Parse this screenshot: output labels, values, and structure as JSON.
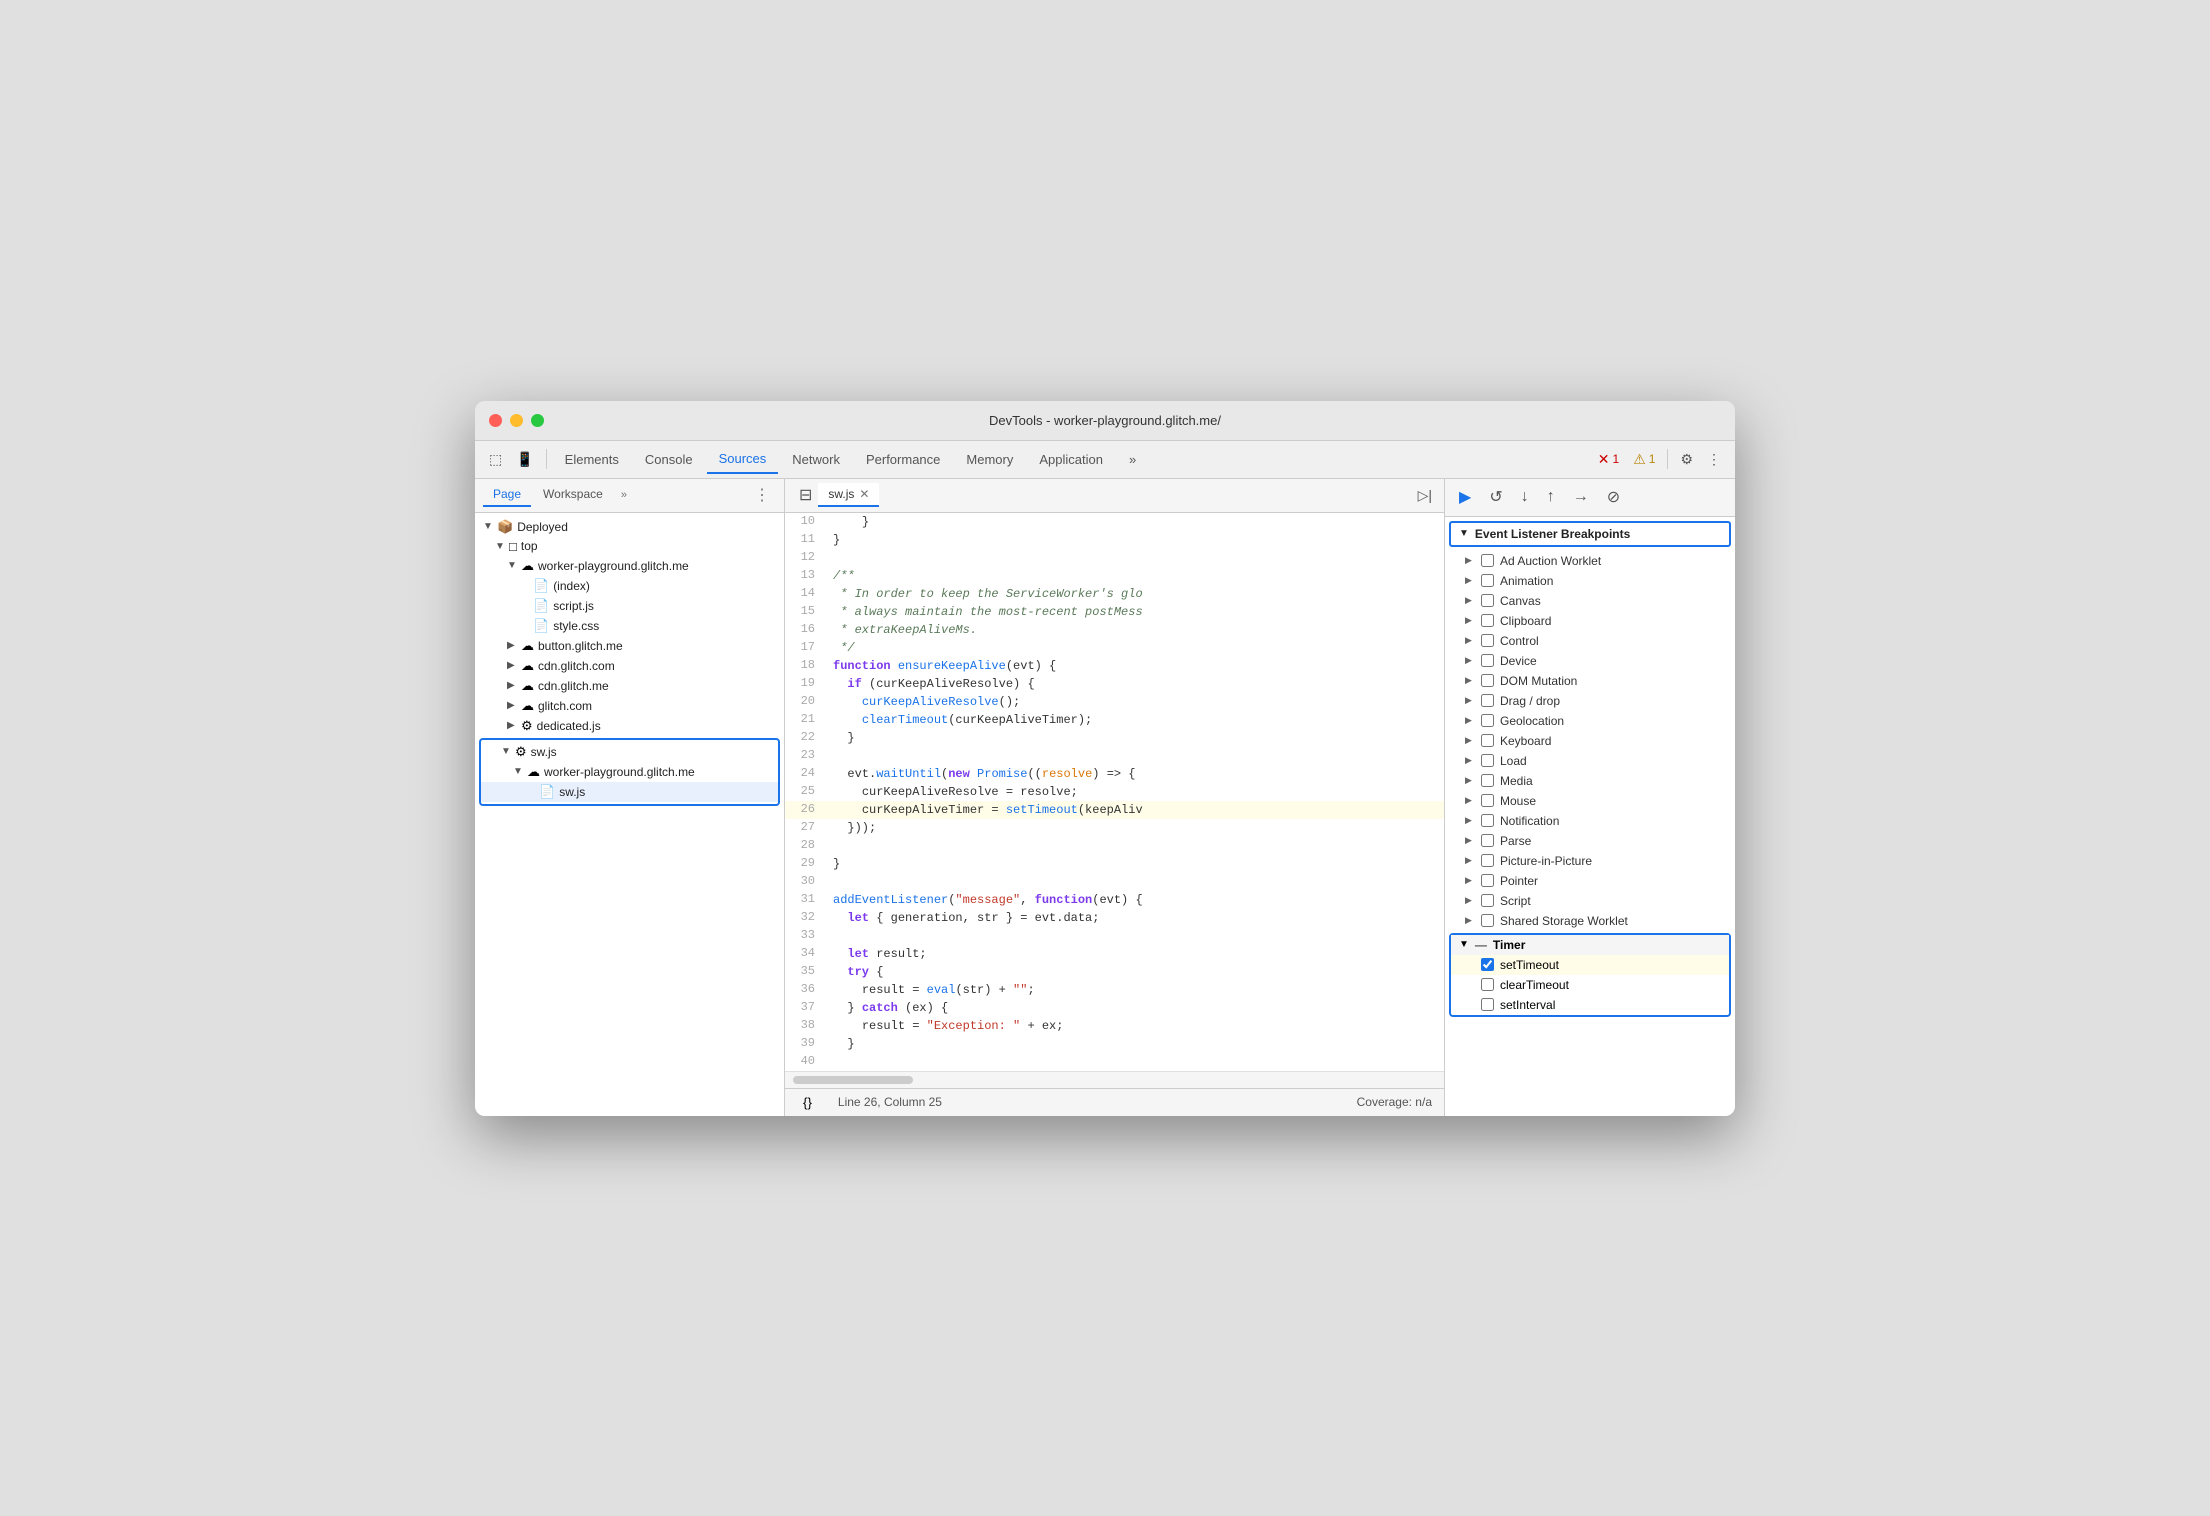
{
  "window": {
    "title": "DevTools - worker-playground.glitch.me/"
  },
  "toolbar": {
    "tabs": [
      {
        "label": "Elements",
        "active": false
      },
      {
        "label": "Console",
        "active": false
      },
      {
        "label": "Sources",
        "active": true
      },
      {
        "label": "Network",
        "active": false
      },
      {
        "label": "Performance",
        "active": false
      },
      {
        "label": "Memory",
        "active": false
      },
      {
        "label": "Application",
        "active": false
      }
    ],
    "more_label": "»",
    "error_count": "1",
    "warning_count": "1"
  },
  "file_panel": {
    "tabs": [
      {
        "label": "Page",
        "active": true
      },
      {
        "label": "Workspace",
        "active": false
      }
    ],
    "more_label": "»",
    "tree": [
      {
        "id": "deployed",
        "label": "Deployed",
        "depth": 0,
        "expanded": true,
        "icon": "📦"
      },
      {
        "id": "top",
        "label": "top",
        "depth": 1,
        "expanded": true,
        "icon": "□"
      },
      {
        "id": "worker-playground",
        "label": "worker-playground.glitch.me",
        "depth": 2,
        "expanded": true,
        "icon": "☁"
      },
      {
        "id": "index",
        "label": "(index)",
        "depth": 3,
        "icon": "📄"
      },
      {
        "id": "script-js",
        "label": "script.js",
        "depth": 3,
        "icon": "📄"
      },
      {
        "id": "style-css",
        "label": "style.css",
        "depth": 3,
        "icon": "📄"
      },
      {
        "id": "button-glitch",
        "label": "button.glitch.me",
        "depth": 2,
        "icon": "☁"
      },
      {
        "id": "cdn-glitch-com",
        "label": "cdn.glitch.com",
        "depth": 2,
        "icon": "☁"
      },
      {
        "id": "cdn-glitch-me",
        "label": "cdn.glitch.me",
        "depth": 2,
        "icon": "☁"
      },
      {
        "id": "glitch-com",
        "label": "glitch.com",
        "depth": 2,
        "icon": "☁"
      },
      {
        "id": "dedicated-js",
        "label": "dedicated.js",
        "depth": 2,
        "icon": "⚙"
      },
      {
        "id": "sw-js-group-start",
        "label": "sw.js",
        "depth": 1,
        "expanded": true,
        "icon": "⚙",
        "group_start": true
      },
      {
        "id": "worker-playground-2",
        "label": "worker-playground.glitch.me",
        "depth": 2,
        "icon": "☁",
        "in_group": true
      },
      {
        "id": "sw-js-file",
        "label": "sw.js",
        "depth": 3,
        "icon": "📄",
        "in_group": true,
        "selected": true
      }
    ]
  },
  "code_panel": {
    "file_tab": "sw.js",
    "lines": [
      {
        "num": 10,
        "content": "    }"
      },
      {
        "num": 11,
        "content": "}"
      },
      {
        "num": 12,
        "content": ""
      },
      {
        "num": 13,
        "content": "/**",
        "type": "comment"
      },
      {
        "num": 14,
        "content": " * In order to keep the ServiceWorker's glo",
        "type": "comment"
      },
      {
        "num": 15,
        "content": " * always maintain the most-recent postMess",
        "type": "comment"
      },
      {
        "num": 16,
        "content": " * extraKeepAliveMs.",
        "type": "comment"
      },
      {
        "num": 17,
        "content": " */",
        "type": "comment"
      },
      {
        "num": 18,
        "content": "function ensureKeepAlive(evt) {",
        "type": "code"
      },
      {
        "num": 19,
        "content": "  if (curKeepAliveResolve) {",
        "type": "code"
      },
      {
        "num": 20,
        "content": "    curKeepAliveResolve();",
        "type": "code"
      },
      {
        "num": 21,
        "content": "    clearTimeout(curKeepAliveTimer);",
        "type": "code"
      },
      {
        "num": 22,
        "content": "  }",
        "type": "code"
      },
      {
        "num": 23,
        "content": ""
      },
      {
        "num": 24,
        "content": "  evt.waitUntil(new Promise((resolve) => {",
        "type": "code"
      },
      {
        "num": 25,
        "content": "    curKeepAliveResolve = resolve;",
        "type": "code"
      },
      {
        "num": 26,
        "content": "    curKeepAliveTimer = setTimeout(keepAliv",
        "type": "code",
        "highlighted": true
      },
      {
        "num": 27,
        "content": "  }));",
        "type": "code"
      },
      {
        "num": 28,
        "content": ""
      },
      {
        "num": 29,
        "content": "}"
      },
      {
        "num": 30,
        "content": ""
      },
      {
        "num": 31,
        "content": "addEventListener(\"message\", function(evt) {",
        "type": "code"
      },
      {
        "num": 32,
        "content": "  let { generation, str } = evt.data;",
        "type": "code"
      },
      {
        "num": 33,
        "content": ""
      },
      {
        "num": 34,
        "content": "  let result;",
        "type": "code"
      },
      {
        "num": 35,
        "content": "  try {",
        "type": "code"
      },
      {
        "num": 36,
        "content": "    result = eval(str) + \"\";",
        "type": "code"
      },
      {
        "num": 37,
        "content": "  } catch (ex) {",
        "type": "code"
      },
      {
        "num": 38,
        "content": "    result = \"Exception: \" + ex;",
        "type": "code"
      },
      {
        "num": 39,
        "content": "  }",
        "type": "code"
      },
      {
        "num": 40,
        "content": ""
      }
    ],
    "status": {
      "format_label": "{}",
      "position": "Line 26, Column 25",
      "coverage": "Coverage: n/a"
    }
  },
  "right_panel": {
    "event_listener_breakpoints_label": "Event Listener Breakpoints",
    "breakpoints": [
      {
        "label": "Ad Auction Worklet",
        "checked": false,
        "expandable": true
      },
      {
        "label": "Animation",
        "checked": false,
        "expandable": true
      },
      {
        "label": "Canvas",
        "checked": false,
        "expandable": true
      },
      {
        "label": "Clipboard",
        "checked": false,
        "expandable": true
      },
      {
        "label": "Control",
        "checked": false,
        "expandable": true
      },
      {
        "label": "Device",
        "checked": false,
        "expandable": true
      },
      {
        "label": "DOM Mutation",
        "checked": false,
        "expandable": true
      },
      {
        "label": "Drag / drop",
        "checked": false,
        "expandable": true
      },
      {
        "label": "Geolocation",
        "checked": false,
        "expandable": true
      },
      {
        "label": "Keyboard",
        "checked": false,
        "expandable": true
      },
      {
        "label": "Load",
        "checked": false,
        "expandable": true
      },
      {
        "label": "Media",
        "checked": false,
        "expandable": true
      },
      {
        "label": "Mouse",
        "checked": false,
        "expandable": true
      },
      {
        "label": "Notification",
        "checked": false,
        "expandable": true
      },
      {
        "label": "Parse",
        "checked": false,
        "expandable": true
      },
      {
        "label": "Picture-in-Picture",
        "checked": false,
        "expandable": true
      },
      {
        "label": "Pointer",
        "checked": false,
        "expandable": true
      },
      {
        "label": "Script",
        "checked": false,
        "expandable": true
      },
      {
        "label": "Shared Storage Worklet",
        "checked": false,
        "expandable": true
      }
    ],
    "timer_group": {
      "label": "Timer",
      "expanded": true,
      "items": [
        {
          "label": "setTimeout",
          "checked": true,
          "active": true
        },
        {
          "label": "clearTimeout",
          "checked": false
        },
        {
          "label": "setInterval",
          "checked": false
        }
      ]
    }
  },
  "debug_toolbar": {
    "buttons": [
      "▶",
      "↺",
      "↓",
      "↑",
      "→",
      "⊘"
    ]
  }
}
